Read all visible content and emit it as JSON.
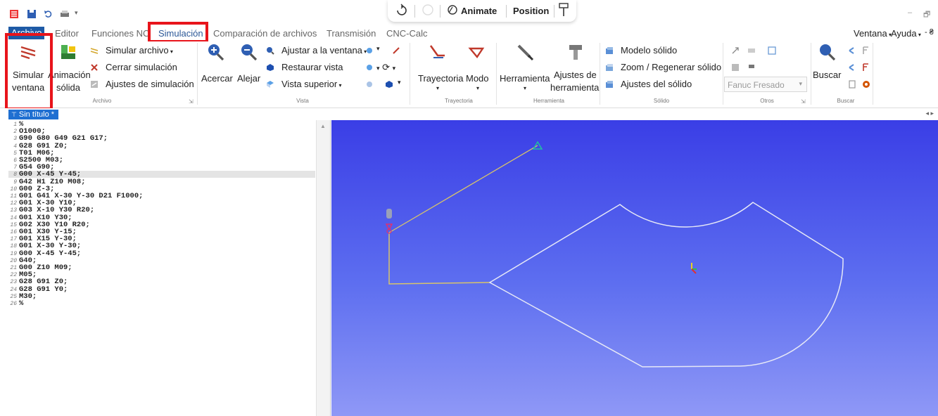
{
  "titlebar": {
    "float_toolbar": {
      "animate_label": "Animate",
      "position_label": "Position"
    },
    "window_controls": {
      "minimize": "–",
      "restore": "🗗"
    }
  },
  "menu": {
    "tabs": [
      {
        "label": "Archivo"
      },
      {
        "label": "Editor"
      },
      {
        "label": "Funciones NC"
      },
      {
        "label": "Simulación"
      },
      {
        "label": "Comparación de archivos"
      },
      {
        "label": "Transmisión"
      },
      {
        "label": "CNC-Calc"
      }
    ],
    "right": {
      "ventana": "Ventana",
      "ayuda": "Ayuda",
      "extra": "- ₴"
    }
  },
  "ribbon": {
    "archivo": {
      "title": "Archivo",
      "simular_ventana_1": "Simular",
      "simular_ventana_2": "ventana",
      "animacion_1": "Animación",
      "animacion_2": "sólida",
      "simular_archivo": "Simular archivo",
      "cerrar_simulacion": "Cerrar simulación",
      "ajustes_simulacion": "Ajustes de simulación"
    },
    "vista": {
      "title": "Vista",
      "acercar": "Acercar",
      "alejar": "Alejar",
      "ajustar": "Ajustar a la ventana",
      "restaurar": "Restaurar vista",
      "superior": "Vista superior"
    },
    "trayectoria": {
      "title": "Trayectoria",
      "trayectoria": "Trayectoria",
      "modo": "Modo"
    },
    "herramienta": {
      "title": "Herramienta",
      "herramienta": "Herramienta",
      "ajustes_1": "Ajustes de",
      "ajustes_2": "herramienta"
    },
    "solido": {
      "title": "Sólido",
      "modelo": "Modelo sólido",
      "zoom": "Zoom / Regenerar sólido",
      "ajustes": "Ajustes del sólido"
    },
    "otros": {
      "title": "Otros",
      "control_select": "Fanuc Fresado"
    },
    "buscar": {
      "title": "Buscar",
      "buscar": "Buscar"
    }
  },
  "document": {
    "tab_label": "Sin título *"
  },
  "editor": {
    "lines": [
      "%",
      "O1000;",
      "G90 G80 G49 G21 G17;",
      "G28 G91 Z0;",
      "T01 M06;",
      "S2500 M03;",
      "G54 G90;",
      "G00 X-45 Y-45;",
      "G42 H1 Z10 M08;",
      "G00 Z-3;",
      "G01 G41 X-30 Y-30 D21 F1000;",
      "G01 X-30 Y10;",
      "G03 X-10 Y30 R20;",
      "G01 X10 Y30;",
      "G02 X30 Y10 R20;",
      "G01 X30 Y-15;",
      "G01 X15 Y-30;",
      "G01 X-30 Y-30;",
      "G00 X-45 Y-45;",
      "G40;",
      "G00 Z10 M09;",
      "M05;",
      "G28 G91 Z0;",
      "G28 G91 Y0;",
      "M30;",
      "%"
    ],
    "highlighted_line": 8
  },
  "colors": {
    "highlight_box": "#e8141b",
    "viewport_top": "#3a3ee6",
    "viewport_bottom": "#8f98f6",
    "toolpath": "#d8c46a",
    "outline": "#e6e8f6"
  }
}
